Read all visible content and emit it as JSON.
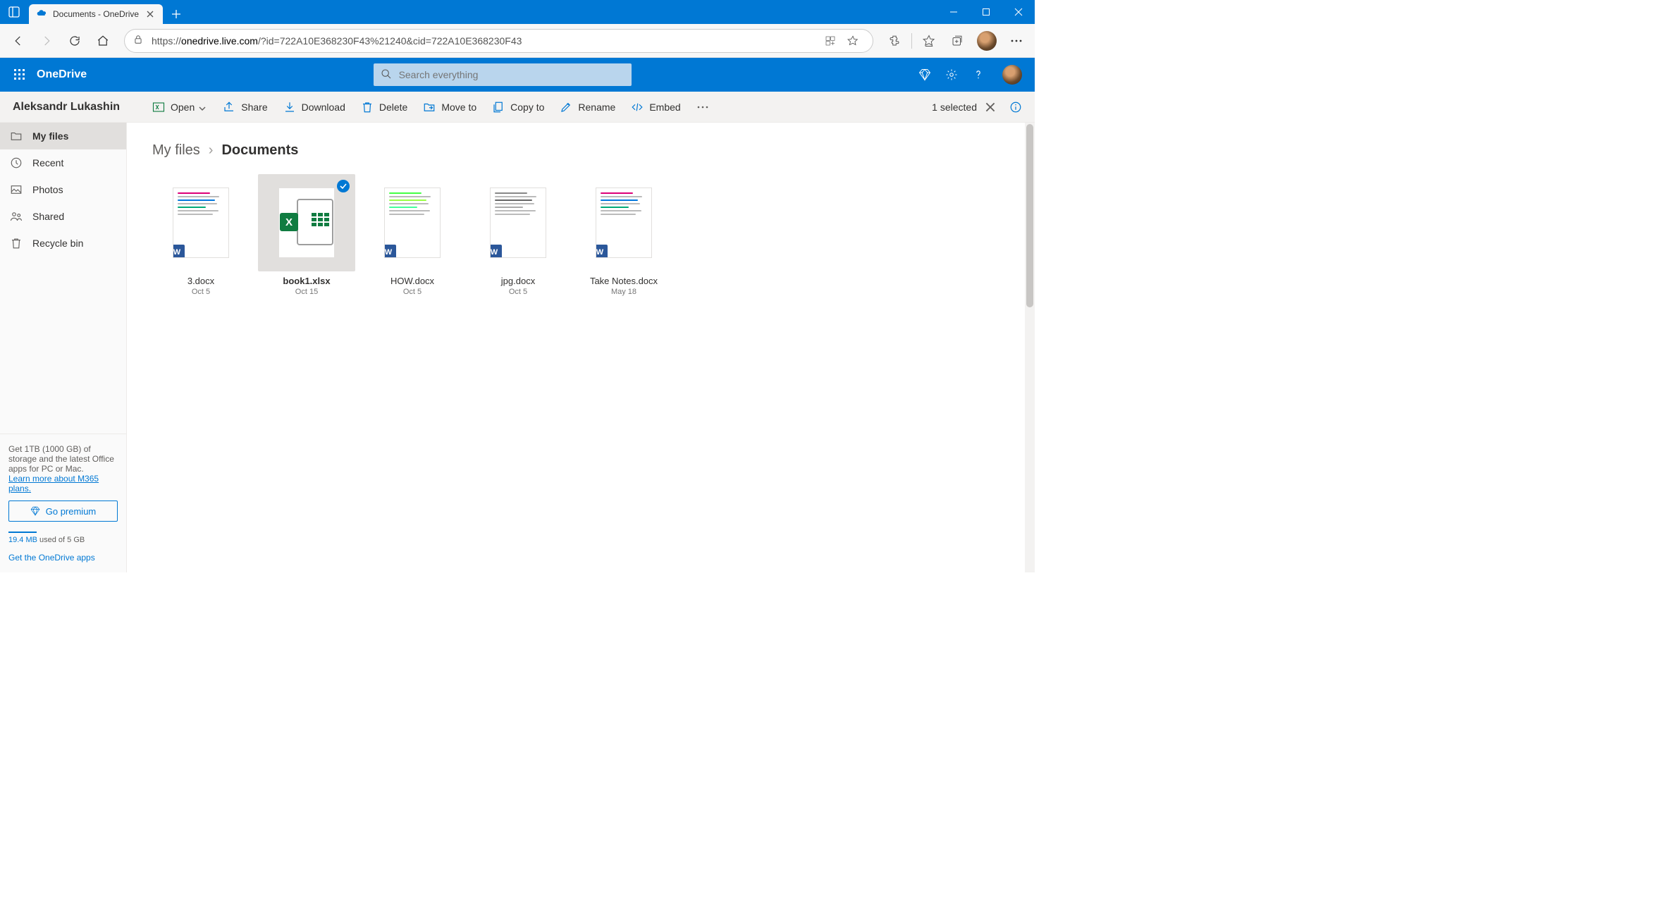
{
  "window": {
    "tab_title": "Documents - OneDrive"
  },
  "address": {
    "scheme": "https://",
    "host": "onedrive.live.com",
    "path": "/?id=722A10E368230F43%21240&cid=722A10E368230F43"
  },
  "app": {
    "name": "OneDrive",
    "search_placeholder": "Search everything"
  },
  "owner": "Aleksandr Lukashin",
  "commands": {
    "open": "Open",
    "share": "Share",
    "download": "Download",
    "delete": "Delete",
    "move": "Move to",
    "copy": "Copy to",
    "rename": "Rename",
    "embed": "Embed"
  },
  "selection": {
    "label": "1 selected"
  },
  "sidebar": {
    "my_files": "My files",
    "recent": "Recent",
    "photos": "Photos",
    "shared": "Shared",
    "recycle": "Recycle bin"
  },
  "promo": {
    "text": "Get 1TB (1000 GB) of storage and the latest Office apps for PC or Mac.",
    "link": "Learn more about M365 plans.",
    "button": "Go premium",
    "storage_used": "19.4 MB",
    "storage_rest": " used of 5 GB",
    "apps_link": "Get the OneDrive apps"
  },
  "breadcrumb": {
    "root": "My files",
    "current": "Documents"
  },
  "files": [
    {
      "name": "3.docx",
      "date": "Oct 5",
      "type": "word",
      "selected": false
    },
    {
      "name": "book1.xlsx",
      "date": "Oct 15",
      "type": "excel",
      "selected": true
    },
    {
      "name": "HOW.docx",
      "date": "Oct 5",
      "type": "word",
      "selected": false
    },
    {
      "name": "jpg.docx",
      "date": "Oct 5",
      "type": "word",
      "selected": false
    },
    {
      "name": "Take Notes.docx",
      "date": "May 18",
      "type": "word",
      "selected": false
    }
  ]
}
